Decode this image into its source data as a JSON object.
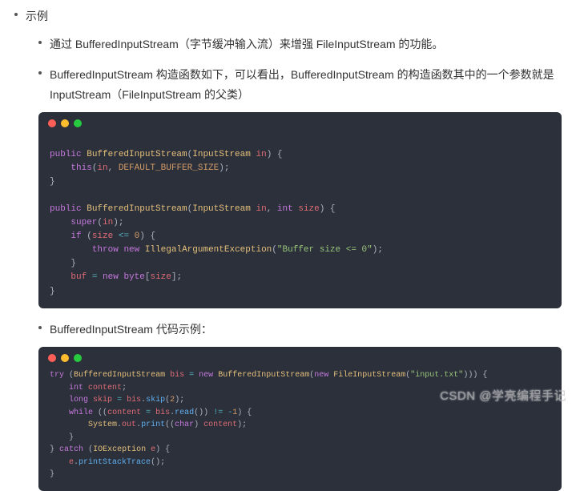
{
  "outer": {
    "label": "示例"
  },
  "items": [
    {
      "text": "通过 BufferedInputStream（字节缓冲输入流）来增强 FileInputStream 的功能。"
    },
    {
      "text": "BufferedInputStream 构造函数如下，可以看出，BufferedInputStream 的构造函数其中的一个参数就是 InputStream（FileInputStream 的父类）"
    },
    {
      "text": "BufferedInputStream 代码示例："
    }
  ],
  "code1": {
    "lang": "java",
    "text": "public BufferedInputStream(InputStream in) {\n    this(in, DEFAULT_BUFFER_SIZE);\n}\n\npublic BufferedInputStream(InputStream in, int size) {\n    super(in);\n    if (size <= 0) {\n        throw new IllegalArgumentException(\"Buffer size <= 0\");\n    }\n    buf = new byte[size];\n}"
  },
  "code2": {
    "lang": "java",
    "text": "try (BufferedInputStream bis = new BufferedInputStream(new FileInputStream(\"input.txt\"))) {\n    int content;\n    long skip = bis.skip(2);\n    while ((content = bis.read()) != -1) {\n        System.out.print((char) content);\n    }\n} catch (IOException e) {\n    e.printStackTrace();\n}"
  },
  "traffic": {
    "red": "close",
    "yellow": "minimize",
    "green": "zoom"
  },
  "watermark": "CSDN @学亮编程手记"
}
